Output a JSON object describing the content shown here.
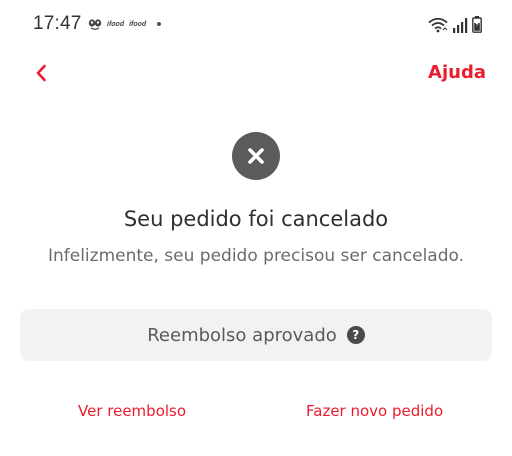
{
  "status_bar": {
    "time": "17:47",
    "notification_labels": [
      "ifood",
      "ifood"
    ],
    "icons": [
      "smiley-icon",
      "ifood-icon",
      "ifood-icon",
      "dot-icon",
      "wifi-icon",
      "signal-icon",
      "battery-icon"
    ]
  },
  "header": {
    "back_icon": "chevron-left-icon",
    "help_label": "Ajuda"
  },
  "main": {
    "status_icon": "close-circle-icon",
    "title": "Seu pedido foi cancelado",
    "subtitle": "Infelizmente, seu pedido precisou ser cancelado.",
    "refund_status": "Reembolso aprovado",
    "refund_help_icon": "question-mark-icon",
    "refund_help_glyph": "?"
  },
  "actions": {
    "view_refund_label": "Ver reembolso",
    "new_order_label": "Fazer novo pedido"
  },
  "colors": {
    "brand_red": "#ea1d2c",
    "icon_gray": "#5b5b5b",
    "box_bg": "#f2f2f2"
  }
}
